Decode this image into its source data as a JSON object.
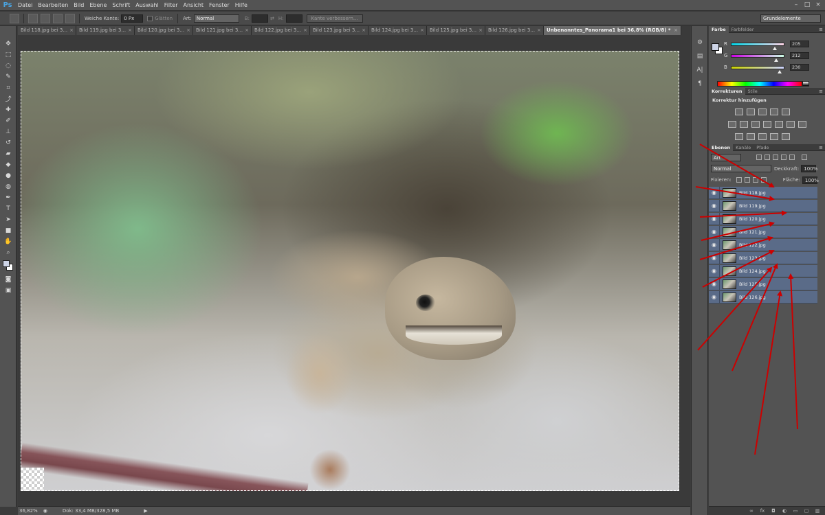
{
  "app": {
    "logo": "Ps",
    "menu": [
      "Datei",
      "Bearbeiten",
      "Bild",
      "Ebene",
      "Schrift",
      "Auswahl",
      "Filter",
      "Ansicht",
      "Fenster",
      "Hilfe"
    ],
    "window_controls": [
      "–",
      "□",
      "×"
    ]
  },
  "options": {
    "feather_label": "Weiche Kante:",
    "feather_value": "0 Px",
    "antialias_label": "Glätten",
    "style_label": "Art:",
    "style_value": "Normal",
    "width_label": "B:",
    "height_label": "H:",
    "refine_button": "Kante verbessern...",
    "workspace": "Grundelemente"
  },
  "tabs": [
    {
      "label": "Bild 118.jpg bei 3...",
      "active": false
    },
    {
      "label": "Bild 119.jpg bei 3...",
      "active": false
    },
    {
      "label": "Bild 120.jpg bei 3...",
      "active": false
    },
    {
      "label": "Bild 121.jpg bei 3...",
      "active": false
    },
    {
      "label": "Bild 122.jpg bei 3...",
      "active": false
    },
    {
      "label": "Bild 123.jpg bei 3...",
      "active": false
    },
    {
      "label": "Bild 124.jpg bei 3...",
      "active": false
    },
    {
      "label": "Bild 125.jpg bei 3...",
      "active": false
    },
    {
      "label": "Bild 126.jpg bei 3...",
      "active": false
    },
    {
      "label": "Unbenanntes_Panorama1 bei 36,8% (RGB/8) *",
      "active": true
    }
  ],
  "tab_close": "×",
  "status": {
    "zoom": "36,82%",
    "doc": "Dok: 33,4 MB/328,5 MB",
    "arrow": "▶"
  },
  "color_panel": {
    "tabs": [
      "Farbe",
      "Farbfelder"
    ],
    "channels": [
      {
        "letter": "R",
        "value": "205",
        "gradient": [
          "#00d4e6",
          "#ffd4e6"
        ]
      },
      {
        "letter": "G",
        "value": "212",
        "gradient": [
          "#cd00e6",
          "#cdffe6"
        ]
      },
      {
        "letter": "B",
        "value": "230",
        "gradient": [
          "#cdd400",
          "#cdd4ff"
        ]
      }
    ],
    "fg_color": "#cdd4e6",
    "bg_color": "#ffffff"
  },
  "adjustments_panel": {
    "tabs": [
      "Korrekturen",
      "Stile"
    ],
    "title": "Korrektur hinzufügen"
  },
  "layers_panel": {
    "tabs": [
      "Ebenen",
      "Kanäle",
      "Pfade"
    ],
    "filter_kind": "Art",
    "blend_mode": "Normal",
    "opacity_label": "Deckkraft:",
    "opacity_value": "100%",
    "lock_label": "Fixieren:",
    "fill_label": "Fläche:",
    "fill_value": "100%",
    "layers": [
      {
        "name": "Bild 118.jpg"
      },
      {
        "name": "Bild 119.jpg"
      },
      {
        "name": "Bild 120.jpg"
      },
      {
        "name": "Bild 121.jpg"
      },
      {
        "name": "Bild 122.jpg"
      },
      {
        "name": "Bild 123.jpg"
      },
      {
        "name": "Bild 124.jpg"
      },
      {
        "name": "Bild 125.jpg"
      },
      {
        "name": "Bild 126.jpg"
      }
    ]
  },
  "icons": {
    "eye": "eye-icon",
    "arrow_color": "#cc0000"
  }
}
